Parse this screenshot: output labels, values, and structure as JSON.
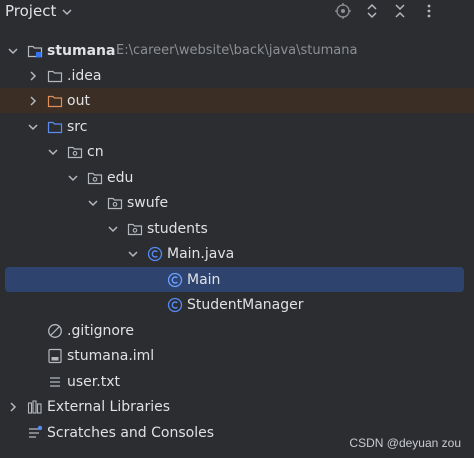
{
  "panel": {
    "title": "Project",
    "toolbar_icons": [
      "crosshair-icon",
      "expand-icon",
      "collapse-icon",
      "more-icon"
    ]
  },
  "tree": {
    "root": {
      "label": "stumana",
      "path": "E:\\career\\website\\back\\java\\stumana"
    },
    "idea": {
      "label": ".idea"
    },
    "out": {
      "label": "out"
    },
    "src": {
      "label": "src"
    },
    "cn": {
      "label": "cn"
    },
    "edu": {
      "label": "edu"
    },
    "swufe": {
      "label": "swufe"
    },
    "students": {
      "label": "students"
    },
    "main_java": {
      "label": "Main.java"
    },
    "main_class": {
      "label": "Main"
    },
    "student_manager": {
      "label": "StudentManager"
    },
    "gitignore": {
      "label": ".gitignore"
    },
    "iml": {
      "label": "stumana.iml"
    },
    "user_txt": {
      "label": "user.txt"
    },
    "external_libraries": {
      "label": "External Libraries"
    },
    "scratches": {
      "label": "Scratches and Consoles"
    }
  },
  "colors": {
    "background": "#2b2d30",
    "selection": "#2e436e",
    "excluded_folder_bg": "#3b2f25",
    "source_folder": "#5b8def",
    "excluded_folder": "#e08d5c",
    "class_icon": "#548af7"
  },
  "watermark": "CSDN @deyuan zou"
}
